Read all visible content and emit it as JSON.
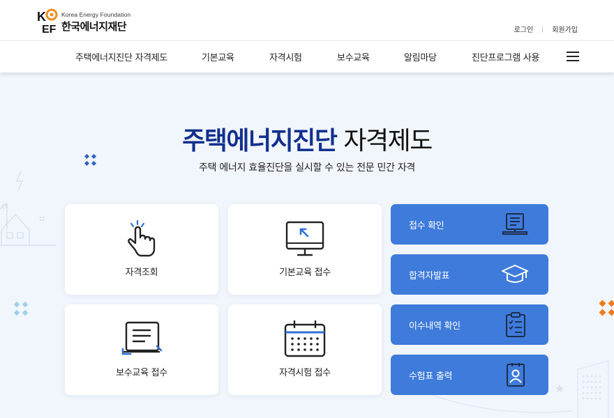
{
  "brand": {
    "english_name": "Korea Energy Foundation",
    "korean_name": "한국에너지재단"
  },
  "util_nav": {
    "login": "로그인",
    "signup": "회원가입"
  },
  "gnb": [
    "주택에너지진단 자격제도",
    "기본교육",
    "자격시험",
    "보수교육",
    "알림마당",
    "진단프로그램 사용"
  ],
  "hero": {
    "title_highlight": "주택에너지진단",
    "title_rest": " 자격제도",
    "subtitle": "주택 에너지 효율진단을 실시할 수 있는 전문 민간 자격"
  },
  "cards": [
    {
      "label": "자격조회",
      "icon": "hand-pointer-icon"
    },
    {
      "label": "기본교육 접수",
      "icon": "monitor-icon"
    },
    {
      "label": "보수교육 접수",
      "icon": "notebook-icon"
    },
    {
      "label": "자격시험 접수",
      "icon": "calendar-icon"
    }
  ],
  "side_buttons": [
    {
      "label": "접수 확인",
      "icon": "laptop-icon"
    },
    {
      "label": "합격자발표",
      "icon": "graduation-cap-icon"
    },
    {
      "label": "이수내역 확인",
      "icon": "clipboard-check-icon"
    },
    {
      "label": "수험표 출력",
      "icon": "id-badge-icon"
    }
  ],
  "colors": {
    "accent_blue": "#3e7bdb",
    "title_navy": "#13308f",
    "logo_orange": "#f08a1d",
    "background": "#f1f6fc"
  }
}
